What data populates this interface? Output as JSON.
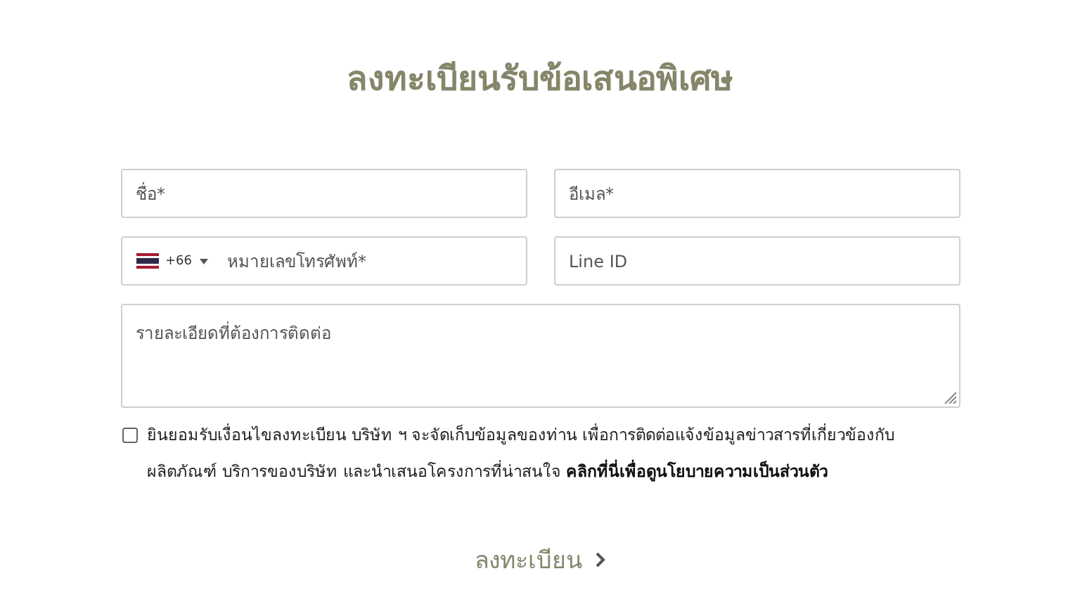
{
  "title": "ลงทะเบียนรับข้อเสนอพิเศษ",
  "fields": [
    {
      "kind": "text",
      "placeholder": "ชื่อ*"
    },
    {
      "kind": "text",
      "placeholder": "อีเมล*"
    },
    {
      "kind": "phone",
      "dial_code": "+66",
      "placeholder": "หมายเลขโทรศัพท์*"
    },
    {
      "kind": "text",
      "placeholder": "Line ID"
    },
    {
      "kind": "textarea",
      "placeholder": "รายละเอียดที่ต้องการติดต่อ"
    }
  ],
  "consent": {
    "checked": false,
    "text": "ยินยอมรับเงื่อนไขลงทะเบียน บริษัท ฯ จะจัดเก็บข้อมูลของท่าน เพื่อการติดต่อแจ้งข้อมูลข่าวสารที่เกี่ยวข้องกับผลิตภัณฑ์ บริการของบริษัท และนำเสนอโครงการที่น่าสนใจ",
    "link": "คลิกที่นี่เพื่อดูนโยบายความเป็นส่วนตัว"
  },
  "submit": {
    "label": "ลงทะเบียน"
  }
}
